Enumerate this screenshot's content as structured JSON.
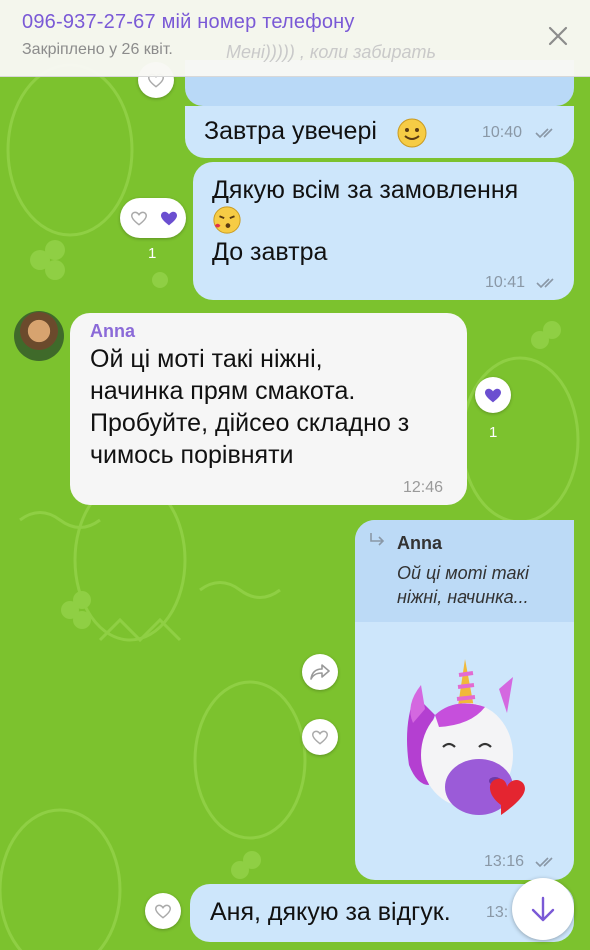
{
  "pinned": {
    "title": "096-937-27-67 мій номер телефону",
    "subtitle": "Закріплено у 26 квіт.",
    "ghost_text": "Мені))))) , коли забирать"
  },
  "messages": [
    {
      "text": "Завтра увечері",
      "time": "10:40",
      "emoji": "slightly-smiling-face"
    },
    {
      "line1": "Дякую всім за замовлення",
      "line2": "До завтра",
      "emoji": "face-blowing-kiss",
      "time": "10:41",
      "reaction_count": "1"
    },
    {
      "sender": "Anna",
      "lines": [
        "Ой ці моті такі ніжні,",
        "начинка прям смакота.",
        "Пробуйте, дійсео складно з",
        "чимось порівняти"
      ],
      "time": "12:46",
      "reaction_count": "1"
    },
    {
      "reply_sender": "Anna",
      "reply_preview_1": "Ой ці моті такі",
      "reply_preview_2": "ніжні, начинка...",
      "sticker": "unicorn-heart-sticker",
      "time": "13:16"
    },
    {
      "text": "Аня, дякую за відгук.",
      "time": "13:"
    }
  ],
  "colors": {
    "background": "#7cc22e",
    "outgoing_bubble": "#cde6fb",
    "incoming_bubble": "#f6f6f6",
    "accent": "#7a59d6",
    "reaction_heart": "#6b4fd0"
  }
}
